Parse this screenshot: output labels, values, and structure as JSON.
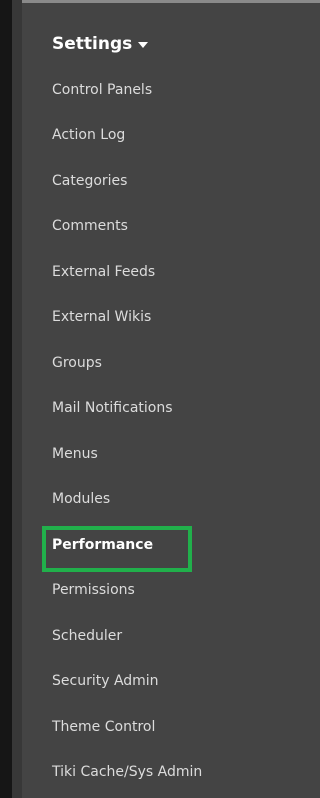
{
  "menu": {
    "title": "Settings",
    "items": [
      {
        "label": "Control Panels"
      },
      {
        "label": "Action Log"
      },
      {
        "label": "Categories"
      },
      {
        "label": "Comments"
      },
      {
        "label": "External Feeds"
      },
      {
        "label": "External Wikis"
      },
      {
        "label": "Groups"
      },
      {
        "label": "Mail Notifications"
      },
      {
        "label": "Menus"
      },
      {
        "label": "Modules"
      },
      {
        "label": "Performance",
        "selected": true
      },
      {
        "label": "Permissions"
      },
      {
        "label": "Scheduler"
      },
      {
        "label": "Security Admin"
      },
      {
        "label": "Theme Control"
      },
      {
        "label": "Tiki Cache/Sys Admin"
      }
    ]
  },
  "colors": {
    "panel_bg": "#444444",
    "highlight": "#21b04b",
    "text": "#dcdcdc"
  }
}
